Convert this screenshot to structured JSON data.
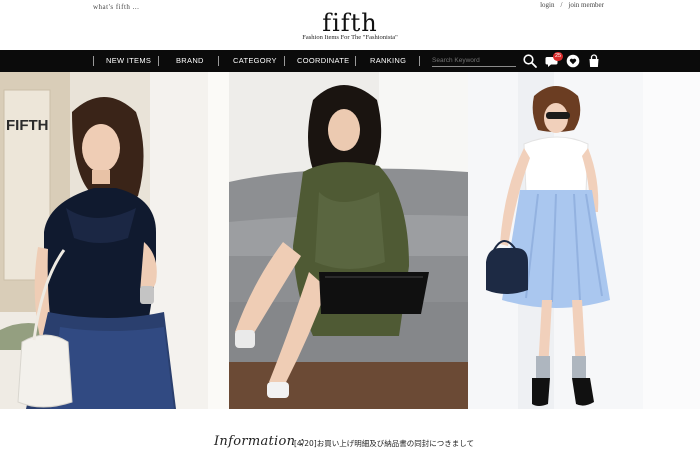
{
  "header": {
    "whats_fifth": "what's fifth ...",
    "login": "login",
    "divider": "/",
    "join": "join member",
    "logo": "fifth",
    "tagline": "Fashion Items For The \"Fashionista\""
  },
  "nav": {
    "items": [
      {
        "label": "NEW ITEMS"
      },
      {
        "label": "BRAND"
      },
      {
        "label": "CATEGORY"
      },
      {
        "label": "COORDINATE"
      },
      {
        "label": "RANKING"
      }
    ],
    "search_placeholder": "Search Keyword",
    "icons": [
      "search-icon",
      "chat-icon",
      "heart-icon",
      "bag-icon"
    ],
    "notification_count": "25",
    "colors": {
      "bar": "#0b0b0b",
      "text": "#ffffff",
      "badge": "#d92b2b"
    }
  },
  "hero": {
    "panels": [
      "model-navy-tulle-skirt",
      "model-olive-shirt-dress-sofa",
      "model-blue-pleated-skirt"
    ],
    "wall_sign": "FIFTH"
  },
  "info": {
    "label": "Information :",
    "text": "[4/20]お買い上げ明細及び納品書の同封につきまして"
  }
}
